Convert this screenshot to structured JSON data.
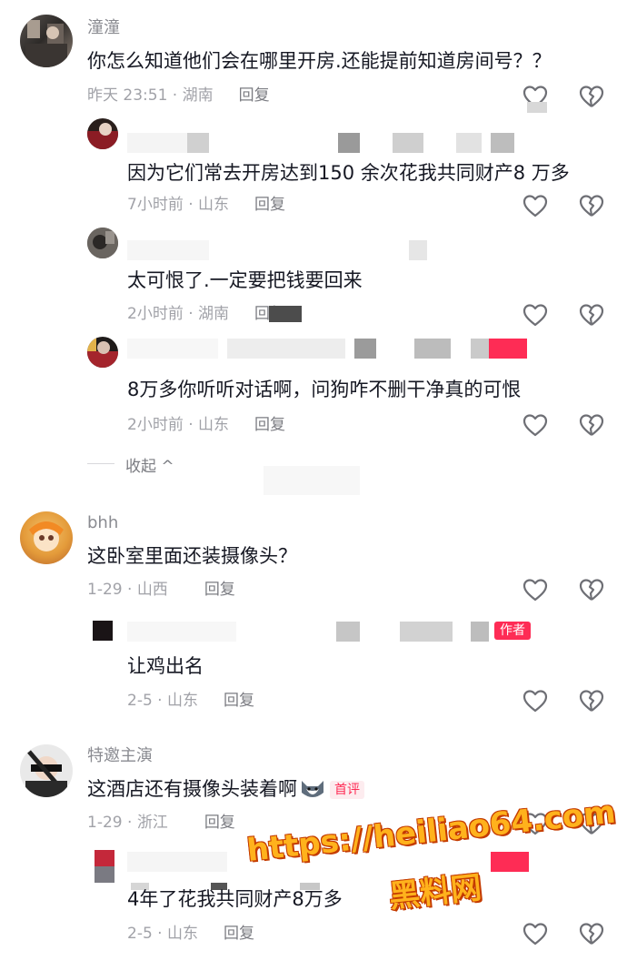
{
  "colors": {
    "text": "#161823",
    "meta": "#a1a2a8",
    "name": "#8a8b91",
    "accent": "#fe2c55",
    "watermark": "#ffb21c"
  },
  "comments": [
    {
      "username": "潼潼",
      "text": "你怎么知道他们会在哪里开房.还能提前知道房间号？？",
      "time": "昨天 23:51",
      "location": "湖南",
      "reply_label": "回复",
      "replies": [
        {
          "username": "",
          "text": "因为它们常去开房达到150 余次花我共同财产8 万多",
          "time": "7小时前",
          "location": "山东",
          "reply_label": "回复"
        },
        {
          "username": "",
          "text": "太可恨了.一定要把钱要回来",
          "time": "2小时前",
          "location": "湖南",
          "reply_label": "回复"
        },
        {
          "username": "",
          "text": "8万多你听听对话啊，问狗咋不删干净真的可恨",
          "time": "2小时前",
          "location": "山东",
          "reply_label": "回复"
        }
      ],
      "collapse_label": "收起 ^"
    },
    {
      "username": "bhh",
      "text": "这卧室里面还装摄像头？",
      "time": "1-29",
      "location": "山西",
      "reply_label": "回复",
      "replies": [
        {
          "username": "",
          "author_tag": "作者",
          "text": "让鸡出名",
          "time": "2-5",
          "location": "山东",
          "reply_label": "回复"
        }
      ]
    },
    {
      "username": "特邀主演",
      "text": "这酒店还有摄像头装着啊",
      "badge": "首评",
      "time": "1-29",
      "location": "浙江",
      "reply_label": "回复",
      "replies": [
        {
          "username": "",
          "text": "4年了花我共同财产8万多",
          "time": "2-5",
          "location": "山东",
          "reply_label": "回复"
        }
      ]
    }
  ],
  "watermark": {
    "url": "https://heiliao64.com",
    "name": "黑料网"
  },
  "icons": {
    "like": "heart-outline-icon",
    "dislike": "broken-heart-icon",
    "emoji": "husky-emoji-icon"
  }
}
